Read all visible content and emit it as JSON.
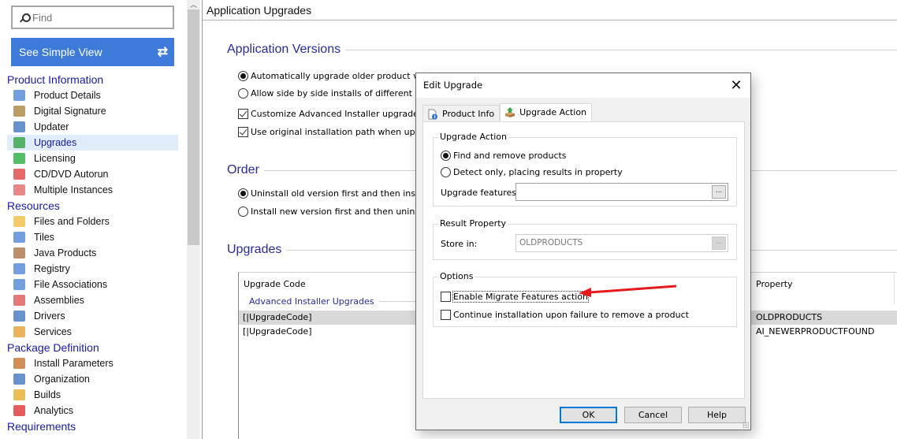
{
  "sidebar": {
    "find_placeholder": "Find",
    "simple_view_label": "See Simple View",
    "categories": [
      {
        "label": "Product Information",
        "items": [
          {
            "label": "Product Details",
            "icon": "product-details-icon",
            "color": "#5a8fd6"
          },
          {
            "label": "Digital Signature",
            "icon": "digital-signature-icon",
            "color": "#b08b4c"
          },
          {
            "label": "Updater",
            "icon": "updater-icon",
            "color": "#4f7fc4"
          },
          {
            "label": "Upgrades",
            "icon": "upgrades-icon",
            "color": "#3aa84a",
            "selected": true
          },
          {
            "label": "Licensing",
            "icon": "licensing-icon",
            "color": "#36b24a"
          },
          {
            "label": "CD/DVD Autorun",
            "icon": "autorun-icon",
            "color": "#e05050"
          },
          {
            "label": "Multiple Instances",
            "icon": "multiple-instances-icon",
            "color": "#e57373"
          }
        ]
      },
      {
        "label": "Resources",
        "items": [
          {
            "label": "Files and Folders",
            "icon": "folder-icon",
            "color": "#f2c14e"
          },
          {
            "label": "Tiles",
            "icon": "tiles-icon",
            "color": "#5a8fd6"
          },
          {
            "label": "Java Products",
            "icon": "java-icon",
            "color": "#b07a4f"
          },
          {
            "label": "Registry",
            "icon": "registry-icon",
            "color": "#5a8fd6"
          },
          {
            "label": "File Associations",
            "icon": "file-associations-icon",
            "color": "#5a8fd6"
          },
          {
            "label": "Assemblies",
            "icon": "assemblies-icon",
            "color": "#e06060"
          },
          {
            "label": "Drivers",
            "icon": "drivers-icon",
            "color": "#4f7fc4"
          },
          {
            "label": "Services",
            "icon": "services-icon",
            "color": "#e8a640"
          }
        ]
      },
      {
        "label": "Package Definition",
        "items": [
          {
            "label": "Install Parameters",
            "icon": "install-parameters-icon",
            "color": "#c87a3a"
          },
          {
            "label": "Organization",
            "icon": "organization-icon",
            "color": "#4f7fc4"
          },
          {
            "label": "Builds",
            "icon": "builds-icon",
            "color": "#e8b23a"
          },
          {
            "label": "Analytics",
            "icon": "analytics-icon",
            "color": "#e04040"
          }
        ]
      },
      {
        "label": "Requirements",
        "items": []
      }
    ]
  },
  "main": {
    "title": "Application Upgrades",
    "sections": {
      "versions": "Application Versions",
      "order": "Order",
      "upgrades": "Upgrades"
    },
    "versions_options": [
      {
        "label": "Automatically upgrade older product versions",
        "type": "radio",
        "checked": true
      },
      {
        "label": "Allow side by side installs of different product versions",
        "type": "radio",
        "checked": false
      },
      {
        "label": "Customize Advanced Installer upgrade rules",
        "type": "checkbox",
        "checked": true
      },
      {
        "label": "Use original installation path when upgrading",
        "type": "checkbox",
        "checked": true
      }
    ],
    "order_options": [
      {
        "label": "Uninstall old version first and then install new version",
        "checked": true
      },
      {
        "label": "Install new version first and then uninstall old version",
        "checked": false
      }
    ],
    "grid": {
      "col_code": "Upgrade Code",
      "col_property": "Property",
      "group": "Advanced Installer Upgrades",
      "rows": [
        {
          "code": "[|UpgradeCode]",
          "property": "OLDPRODUCTS",
          "selected": true
        },
        {
          "code": "[|UpgradeCode]",
          "property": "AI_NEWERPRODUCTFOUND",
          "selected": false
        }
      ]
    }
  },
  "dialog": {
    "title": "Edit Upgrade",
    "close": "✕",
    "tabs": [
      {
        "label": "Product Info",
        "active": false
      },
      {
        "label": "Upgrade Action",
        "active": true
      }
    ],
    "upgrade_action": {
      "legend": "Upgrade Action",
      "find_remove": "Find and remove products",
      "detect_only": "Detect only, placing results in property",
      "selected": "find_remove",
      "features_label": "Upgrade features:",
      "features_value": ""
    },
    "result_property": {
      "legend": "Result Property",
      "store_label": "Store in:",
      "store_value": "OLDPRODUCTS"
    },
    "options": {
      "legend": "Options",
      "migrate": "Enable Migrate Features action",
      "migrate_checked": false,
      "continue": "Continue installation upon failure to remove a product",
      "continue_checked": false
    },
    "browse_label": "...",
    "buttons": {
      "ok": "OK",
      "cancel": "Cancel",
      "help": "Help"
    }
  },
  "annotation": {
    "arrow_color": "#e8191c"
  },
  "colors": {
    "accent": "#3e7bd9",
    "category": "#1a1aa6",
    "selected_bg": "#e1ecfa"
  }
}
